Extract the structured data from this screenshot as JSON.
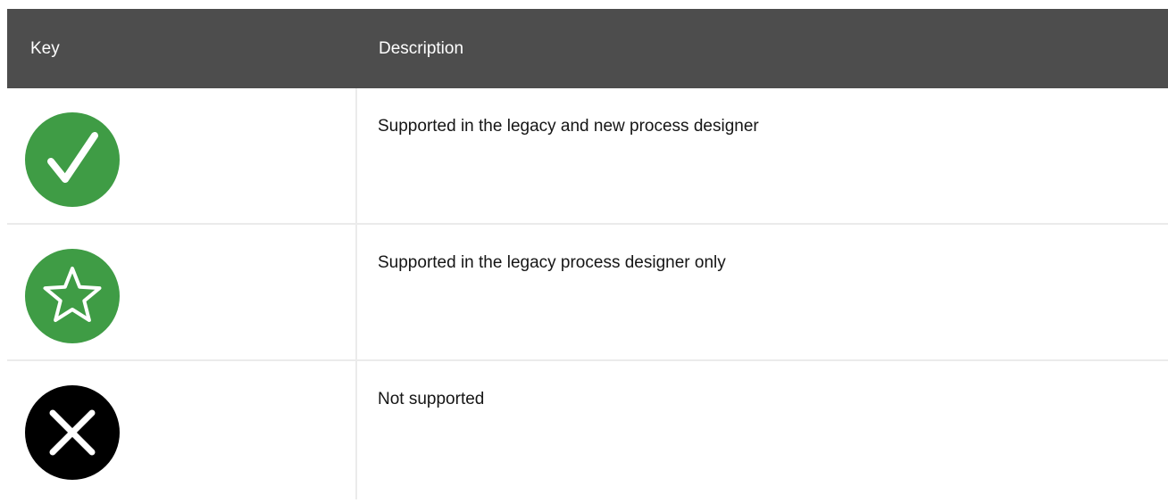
{
  "table": {
    "headers": {
      "key": "Key",
      "description": "Description"
    },
    "rows": [
      {
        "icon": "check-circle-icon",
        "icon_color": "#3f9c45",
        "description": "Supported in the legacy and new process designer"
      },
      {
        "icon": "star-circle-icon",
        "icon_color": "#3f9c45",
        "description": "Supported in the legacy process designer only"
      },
      {
        "icon": "x-circle-icon",
        "icon_color": "#000000",
        "description": "Not supported"
      }
    ]
  }
}
